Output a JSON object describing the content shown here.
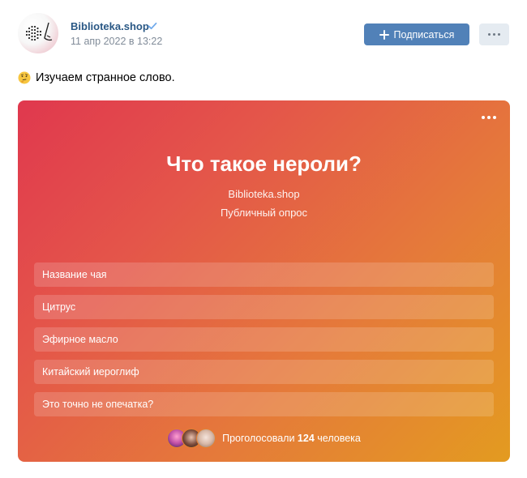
{
  "post": {
    "author_name": "Biblioteka.shop",
    "date": "11 апр 2022 в 13:22",
    "subscribe_label": "Подписаться",
    "text": "Изучаем странное слово.",
    "text_emoji": "thinking-face-icon"
  },
  "poll": {
    "title": "Что такое нероли?",
    "author": "Biblioteka.shop",
    "type": "Публичный опрос",
    "options": [
      {
        "label": "Название чая"
      },
      {
        "label": "Цитрус"
      },
      {
        "label": "Эфирное масло"
      },
      {
        "label": "Китайский иероглиф"
      },
      {
        "label": "Это точно не опечатка?"
      }
    ],
    "voters": {
      "prefix": "Проголосовали",
      "count": "124",
      "suffix": "человека"
    }
  },
  "colors": {
    "link": "#2a5885",
    "button": "#5181b8",
    "gradient_start": "#e0384e",
    "gradient_end": "#e39b20"
  }
}
